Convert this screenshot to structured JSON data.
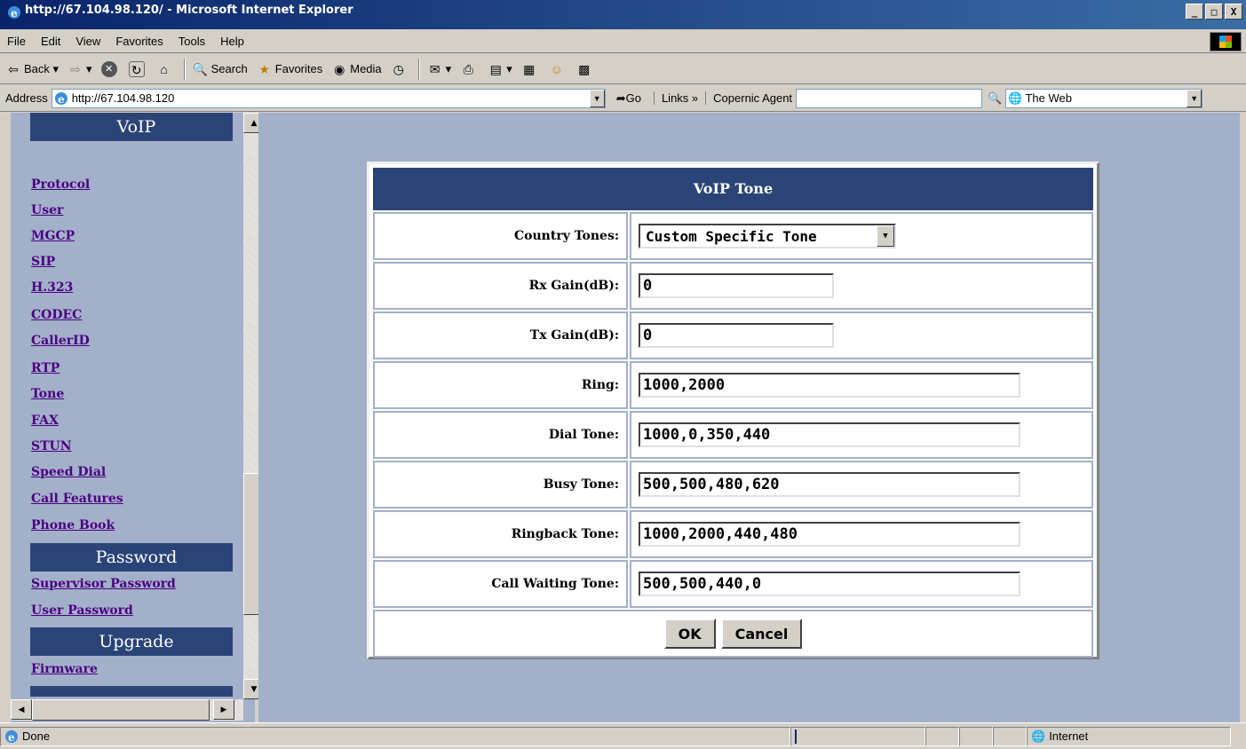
{
  "window": {
    "title": "http://67.104.98.120/ - Microsoft Internet Explorer",
    "min_label": "_",
    "max_label": "□",
    "close_label": "X"
  },
  "menu": [
    "File",
    "Edit",
    "View",
    "Favorites",
    "Tools",
    "Help"
  ],
  "toolbar": {
    "back": "Back",
    "search": "Search",
    "favorites": "Favorites",
    "media": "Media"
  },
  "addressbar": {
    "label": "Address",
    "url": "http://67.104.98.120",
    "go": "Go",
    "links": "Links",
    "copernic": "Copernic Agent",
    "search_scope": "The Web"
  },
  "sidebar": {
    "sections": [
      {
        "title": "VoIP"
      },
      {
        "title": "Password"
      },
      {
        "title": "Upgrade"
      }
    ],
    "voip_links": [
      "Protocol",
      "User",
      "MGCP",
      "SIP",
      "H.323",
      "CODEC",
      "CallerID",
      "RTP",
      "Tone",
      "FAX",
      "STUN",
      "Speed Dial",
      "Call Features",
      "Phone Book"
    ],
    "password_links": [
      "Supervisor Password",
      "User Password"
    ],
    "upgrade_links": [
      "Firmware"
    ]
  },
  "form": {
    "title": "VoIP Tone",
    "country_tones": {
      "label": "Country Tones:",
      "value": "Custom Specific Tone"
    },
    "rx_gain": {
      "label": "Rx Gain(dB):",
      "value": "0"
    },
    "tx_gain": {
      "label": "Tx Gain(dB):",
      "value": "0"
    },
    "ring": {
      "label": "Ring:",
      "value": "1000,2000"
    },
    "dial_tone": {
      "label": "Dial Tone:",
      "value": "1000,0,350,440"
    },
    "busy_tone": {
      "label": "Busy Tone:",
      "value": "500,500,480,620"
    },
    "ringback_tone": {
      "label": "Ringback Tone:",
      "value": "1000,2000,440,480"
    },
    "call_waiting_tone": {
      "label": "Call Waiting Tone:",
      "value": "500,500,440,0"
    },
    "ok_label": "OK",
    "cancel_label": "Cancel"
  },
  "status": {
    "text": "Done",
    "zone": "Internet"
  },
  "colors": {
    "nav_header": "#2b4478",
    "frame_bg": "#a3b0c9",
    "link": "#4b0082"
  }
}
